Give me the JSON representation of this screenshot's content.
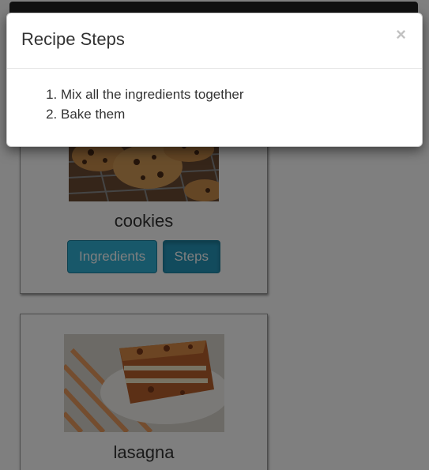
{
  "modal": {
    "title": "Recipe Steps",
    "close_label": "×",
    "steps": [
      "Mix all the ingredients together",
      "Bake them"
    ]
  },
  "recipes": [
    {
      "name": "cookies",
      "buttons": {
        "ingredients": "Ingredients",
        "steps": "Steps"
      }
    },
    {
      "name": "lasagna"
    }
  ],
  "colors": {
    "button_bg": "#31b0d5",
    "button_border": "#1b809e",
    "topbar": "#222222",
    "backdrop": "rgba(0,0,0,0.5)"
  }
}
